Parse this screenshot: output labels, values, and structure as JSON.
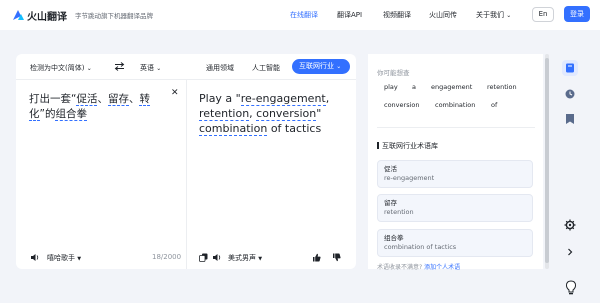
{
  "header": {
    "brand": "火山翻译",
    "tagline": "字节跳动旗下机器翻译品牌",
    "nav": [
      "在线翻译",
      "翻译API",
      "视频翻译",
      "火山同传",
      "关于我们"
    ],
    "lang_button": "En",
    "login_button": "登录"
  },
  "toolbar": {
    "source_lang": "检测为中文(简体)",
    "target_lang": "英语",
    "domain_general": "通用领域",
    "domain_ai": "人工智能",
    "domain_active": "互联网行业"
  },
  "source": {
    "text_pre": "打出一套“",
    "term1": "促活",
    "sep1": "、",
    "term2": "留存",
    "sep2": "、",
    "term3": "转化",
    "text_post": "”的",
    "term4": "组合拳",
    "speaker": "嘻哈歌手",
    "count": "18/2000"
  },
  "target": {
    "pre": "Play a \"",
    "t1": "re-engagement",
    "s1": ", ",
    "t2": "retention",
    "s2": ", ",
    "t3": "conversion",
    "mid": "\" ",
    "t4": "combination",
    "post": " of tactics",
    "speaker": "美式男声"
  },
  "side": {
    "alt_label": "你可能想查",
    "chips": [
      "play",
      "a",
      "engagement",
      "retention",
      "conversion",
      "combination",
      "of"
    ],
    "glossary_title": "互联网行业术语库",
    "glossary": [
      {
        "cn": "促活",
        "en": "re-engagement"
      },
      {
        "cn": "留存",
        "en": "retention"
      },
      {
        "cn": "组合拳",
        "en": "combination of tactics"
      }
    ],
    "footer_note": "术语收录不满意?",
    "footer_link": "添加个人术语"
  },
  "colors": {
    "accent": "#3370ff",
    "background": "#f2f4f9"
  },
  "icons": [
    "logo-icon",
    "swap-icon",
    "clear-icon",
    "speaker-icon",
    "copy-icon",
    "thumb-up-icon",
    "thumb-down-icon",
    "translate-panel-icon",
    "history-icon",
    "bookmark-icon",
    "settings-icon",
    "expand-icon",
    "lightbulb-icon"
  ]
}
